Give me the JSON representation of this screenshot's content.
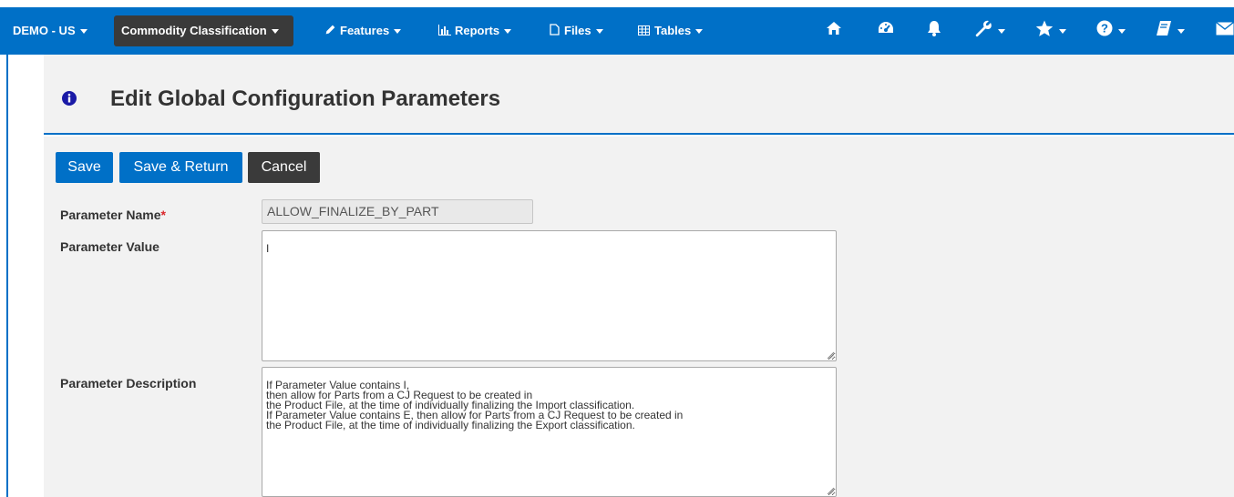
{
  "navbar": {
    "company": "DEMO - US",
    "module": "Commodity Classification",
    "menus": [
      {
        "label": "Features",
        "icon": "pencil-icon"
      },
      {
        "label": "Reports",
        "icon": "bar-chart-icon"
      },
      {
        "label": "Files",
        "icon": "file-icon"
      },
      {
        "label": "Tables",
        "icon": "table-icon"
      }
    ],
    "icons": [
      "home-icon",
      "dashboard-icon",
      "bell-icon",
      "wrench-icon",
      "star-icon",
      "help-icon",
      "book-icon",
      "envelope-icon"
    ],
    "color": "#0070c7"
  },
  "page": {
    "title": "Edit Global Configuration Parameters"
  },
  "toolbar": {
    "save_label": "Save",
    "save_return_label": "Save & Return",
    "cancel_label": "Cancel"
  },
  "form": {
    "parameter_name_label": "Parameter Name",
    "parameter_name_required": "*",
    "parameter_name_value": "ALLOW_FINALIZE_BY_PART",
    "parameter_value_label": "Parameter Value",
    "parameter_value": "I",
    "parameter_description_label": "Parameter Description",
    "parameter_description": "If Parameter Value contains I,\nthen allow for Parts from a CJ Request to be created in\nthe Product File, at the time of individually finalizing the Import classification.\nIf Parameter Value contains E, then allow for Parts from a CJ Request to be created in\nthe Product File, at the time of individually finalizing the Export classification."
  }
}
